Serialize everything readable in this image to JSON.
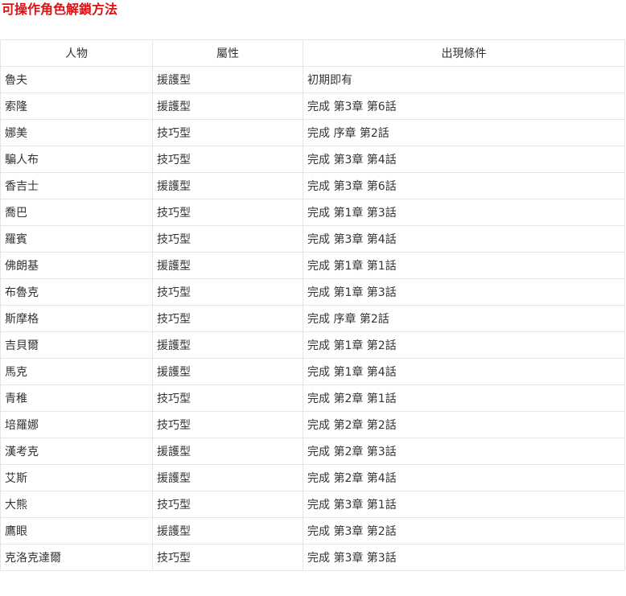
{
  "page": {
    "title": "可操作角色解鎖方法"
  },
  "table": {
    "headers": [
      "人物",
      "屬性",
      "出現條件"
    ],
    "rows": [
      [
        "魯夫",
        "援護型",
        "初期即有"
      ],
      [
        "索隆",
        "援護型",
        "完成 第3章 第6話"
      ],
      [
        "娜美",
        "技巧型",
        "完成 序章 第2話"
      ],
      [
        "騙人布",
        "技巧型",
        "完成 第3章 第4話"
      ],
      [
        "香吉士",
        "援護型",
        "完成 第3章 第6話"
      ],
      [
        "喬巴",
        "技巧型",
        "完成 第1章 第3話"
      ],
      [
        "羅賓",
        "技巧型",
        "完成 第3章 第4話"
      ],
      [
        "佛朗基",
        "援護型",
        "完成 第1章 第1話"
      ],
      [
        "布魯克",
        "技巧型",
        "完成 第1章 第3話"
      ],
      [
        "斯摩格",
        "技巧型",
        "完成 序章 第2話"
      ],
      [
        "吉貝爾",
        "援護型",
        "完成 第1章 第2話"
      ],
      [
        "馬克",
        "援護型",
        "完成 第1章 第4話"
      ],
      [
        "青稚",
        "技巧型",
        "完成 第2章 第1話"
      ],
      [
        "培羅娜",
        "技巧型",
        "完成 第2章 第2話"
      ],
      [
        "漢考克",
        "援護型",
        "完成 第2章 第3話"
      ],
      [
        "艾斯",
        "援護型",
        "完成 第2章 第4話"
      ],
      [
        "大熊",
        "技巧型",
        "完成 第3章 第1話"
      ],
      [
        "鷹眼",
        "援護型",
        "完成 第3章 第2話"
      ],
      [
        "克洛克達爾",
        "技巧型",
        "完成 第3章 第3話"
      ]
    ]
  },
  "colors": {
    "title": "#dd1111",
    "border": "#dfe6ec",
    "text": "#333333"
  }
}
